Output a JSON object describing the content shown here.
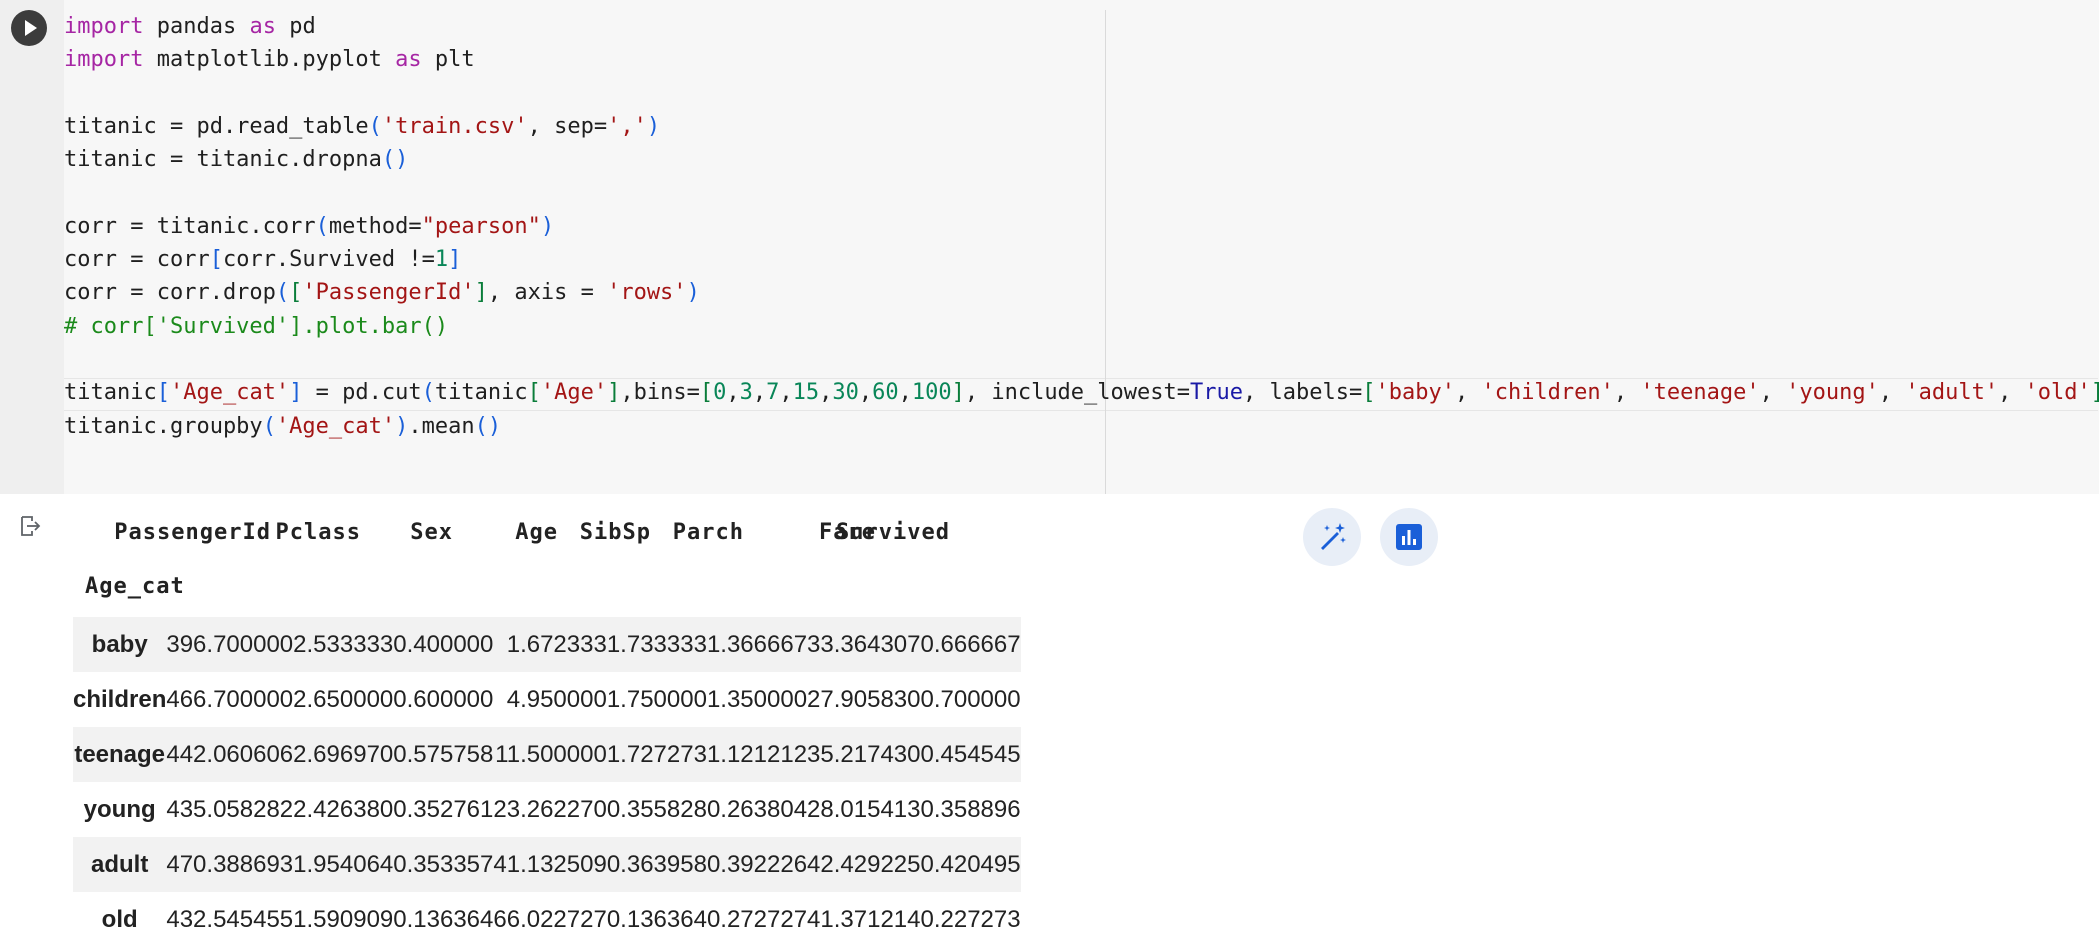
{
  "code": {
    "lines": [
      [
        {
          "t": "import",
          "c": "kw"
        },
        {
          "t": " pandas "
        },
        {
          "t": "as",
          "c": "kw"
        },
        {
          "t": " pd"
        }
      ],
      [
        {
          "t": "import",
          "c": "kw"
        },
        {
          "t": " matplotlib.pyplot "
        },
        {
          "t": "as",
          "c": "kw"
        },
        {
          "t": " plt"
        }
      ],
      [],
      [
        {
          "t": "titanic = pd.read_table"
        },
        {
          "t": "(",
          "c": "paren"
        },
        {
          "t": "'train.csv'",
          "c": "str"
        },
        {
          "t": ", sep="
        },
        {
          "t": "','",
          "c": "str"
        },
        {
          "t": ")",
          "c": "paren"
        }
      ],
      [
        {
          "t": "titanic = titanic.dropna"
        },
        {
          "t": "()",
          "c": "paren"
        }
      ],
      [],
      [
        {
          "t": "corr = titanic.corr"
        },
        {
          "t": "(",
          "c": "paren"
        },
        {
          "t": "method="
        },
        {
          "t": "\"pearson\"",
          "c": "str"
        },
        {
          "t": ")",
          "c": "paren"
        }
      ],
      [
        {
          "t": "corr = corr"
        },
        {
          "t": "[",
          "c": "paren"
        },
        {
          "t": "corr.Survived !="
        },
        {
          "t": "1",
          "c": "num"
        },
        {
          "t": "]",
          "c": "paren"
        }
      ],
      [
        {
          "t": "corr = corr.drop"
        },
        {
          "t": "(",
          "c": "paren"
        },
        {
          "t": "[",
          "c": "brk"
        },
        {
          "t": "'PassengerId'",
          "c": "str"
        },
        {
          "t": "]",
          "c": "brk"
        },
        {
          "t": ", axis = "
        },
        {
          "t": "'rows'",
          "c": "str"
        },
        {
          "t": ")",
          "c": "paren"
        }
      ],
      [
        {
          "t": "# corr['Survived'].plot.bar()",
          "c": "cmt"
        }
      ],
      [],
      [
        {
          "t": "titanic"
        },
        {
          "t": "[",
          "c": "paren"
        },
        {
          "t": "'Age_cat'",
          "c": "str"
        },
        {
          "t": "]",
          "c": "paren"
        },
        {
          "t": " = pd.cut"
        },
        {
          "t": "(",
          "c": "paren"
        },
        {
          "t": "titanic"
        },
        {
          "t": "[",
          "c": "brk"
        },
        {
          "t": "'Age'",
          "c": "str"
        },
        {
          "t": "]",
          "c": "brk"
        },
        {
          "t": ",bins="
        },
        {
          "t": "[",
          "c": "brk"
        },
        {
          "t": "0",
          "c": "num"
        },
        {
          "t": ","
        },
        {
          "t": "3",
          "c": "num"
        },
        {
          "t": ","
        },
        {
          "t": "7",
          "c": "num"
        },
        {
          "t": ","
        },
        {
          "t": "15",
          "c": "num"
        },
        {
          "t": ","
        },
        {
          "t": "30",
          "c": "num"
        },
        {
          "t": ","
        },
        {
          "t": "60",
          "c": "num"
        },
        {
          "t": ","
        },
        {
          "t": "100",
          "c": "num"
        },
        {
          "t": "]",
          "c": "brk"
        },
        {
          "t": ", include_lowest="
        },
        {
          "t": "True",
          "c": "bool"
        },
        {
          "t": ", labels="
        },
        {
          "t": "[",
          "c": "brk"
        },
        {
          "t": "'baby'",
          "c": "str"
        },
        {
          "t": ", "
        },
        {
          "t": "'children'",
          "c": "str"
        },
        {
          "t": ", "
        },
        {
          "t": "'teenage'",
          "c": "str"
        },
        {
          "t": ", "
        },
        {
          "t": "'young'",
          "c": "str"
        },
        {
          "t": ", "
        },
        {
          "t": "'adult'",
          "c": "str"
        },
        {
          "t": ", "
        },
        {
          "t": "'old'",
          "c": "str"
        },
        {
          "t": "]",
          "c": "brk"
        },
        {
          "t": ")",
          "c": "paren"
        }
      ],
      [
        {
          "t": "titanic.groupby"
        },
        {
          "t": "(",
          "c": "paren"
        },
        {
          "t": "'Age_cat'",
          "c": "str"
        },
        {
          "t": ")",
          "c": "paren"
        },
        {
          "t": ".mean"
        },
        {
          "t": "()",
          "c": "paren"
        }
      ]
    ]
  },
  "output": {
    "index_name": "Age_cat",
    "columns": [
      "PassengerId",
      "Pclass",
      "Sex",
      "Age",
      "SibSp",
      "Parch",
      "Fare",
      "Survived"
    ],
    "rows": [
      {
        "label": "baby",
        "values": [
          "396.700000",
          "2.533333",
          "0.400000",
          "1.672333",
          "1.733333",
          "1.366667",
          "33.364307",
          "0.666667"
        ]
      },
      {
        "label": "children",
        "values": [
          "466.700000",
          "2.650000",
          "0.600000",
          "4.950000",
          "1.750000",
          "1.350000",
          "27.905830",
          "0.700000"
        ]
      },
      {
        "label": "teenage",
        "values": [
          "442.060606",
          "2.696970",
          "0.575758",
          "11.500000",
          "1.727273",
          "1.121212",
          "35.217430",
          "0.454545"
        ]
      },
      {
        "label": "young",
        "values": [
          "435.058282",
          "2.426380",
          "0.352761",
          "23.262270",
          "0.355828",
          "0.263804",
          "28.015413",
          "0.358896"
        ]
      },
      {
        "label": "adult",
        "values": [
          "470.388693",
          "1.954064",
          "0.353357",
          "41.132509",
          "0.363958",
          "0.392226",
          "42.429225",
          "0.420495"
        ]
      },
      {
        "label": "old",
        "values": [
          "432.545455",
          "1.590909",
          "0.136364",
          "66.022727",
          "0.136364",
          "0.272727",
          "41.371214",
          "0.227273"
        ]
      }
    ]
  },
  "icons": {
    "run": "play-icon",
    "output": "output-arrow-icon",
    "magic": "magic-wand-icon",
    "chart": "bar-chart-icon"
  },
  "colors": {
    "keyword": "#a626a4",
    "string": "#a31515",
    "number": "#098658",
    "accent": "#1a5fd8"
  }
}
